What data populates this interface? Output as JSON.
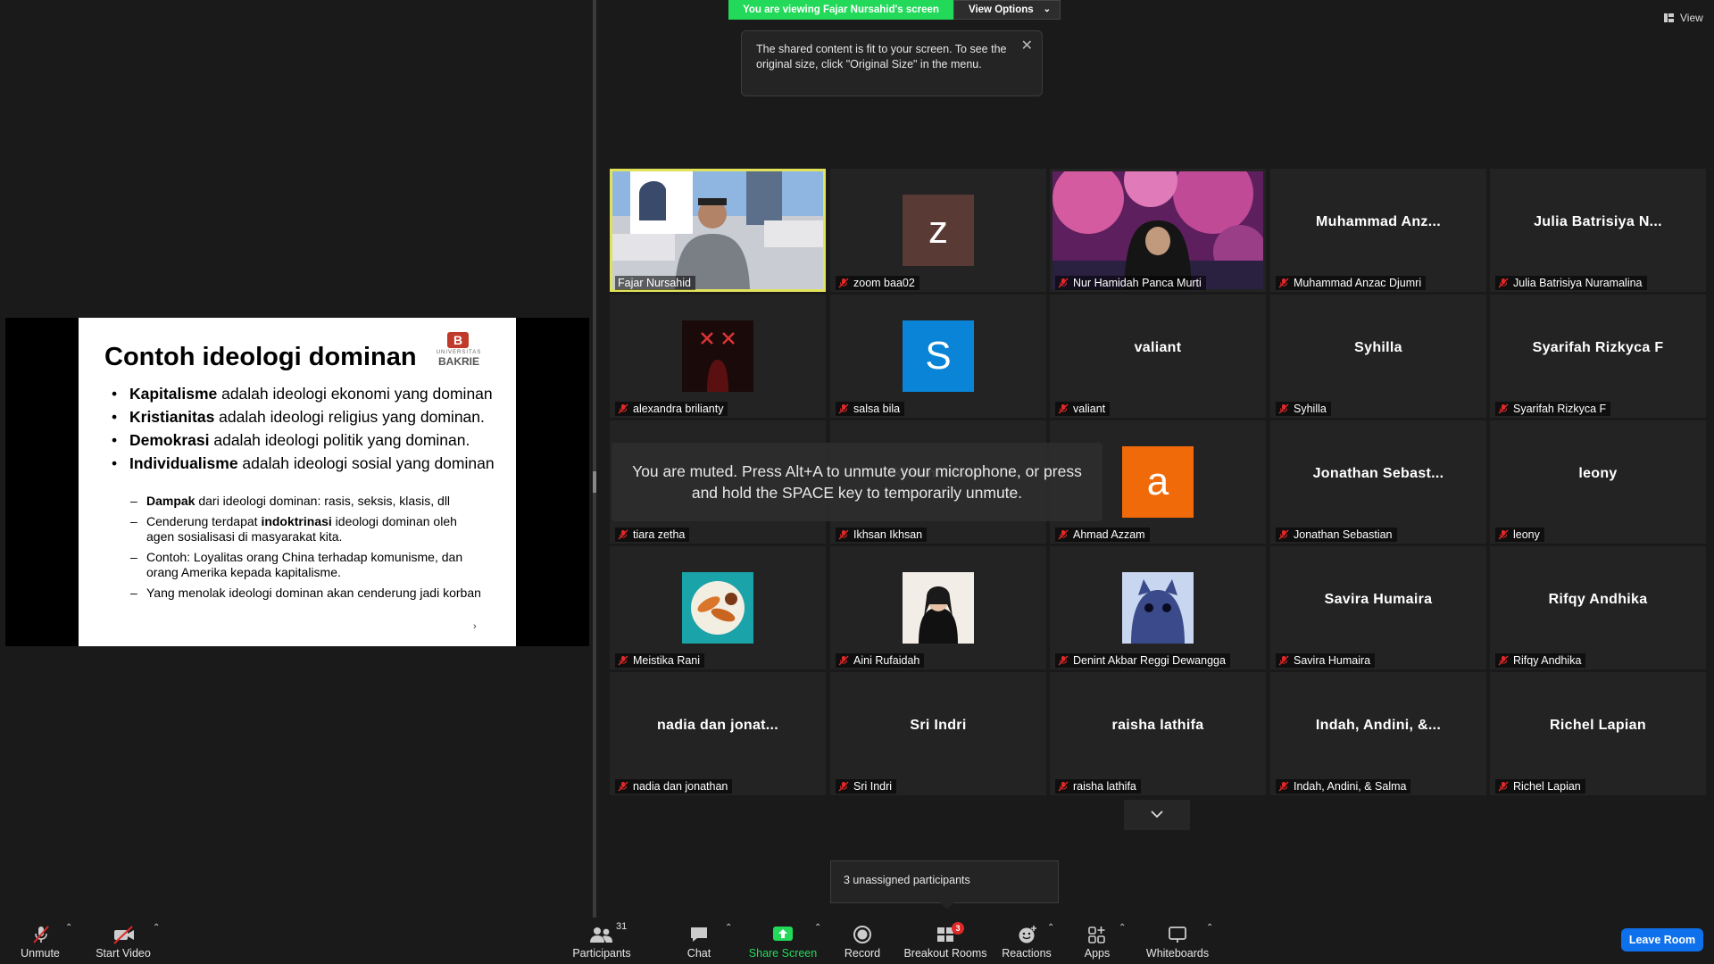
{
  "banner": {
    "viewing": "You are viewing Fajar Nursahid's screen",
    "view_options": "View Options"
  },
  "tooltip": {
    "text": "The shared content is fit to your screen. To see the original size, click \"Original Size\" in the menu."
  },
  "view_button": {
    "label": "View"
  },
  "slide": {
    "title": "Contoh ideologi dominan",
    "logo": {
      "line1": "UNIVERSITAS",
      "line2": "BAKRIE",
      "mark": "B"
    },
    "bullets": [
      {
        "bold": "Kapitalisme",
        "rest": " adalah ideologi ekonomi yang dominan"
      },
      {
        "bold": "Kristianitas",
        "rest": " adalah ideologi religius yang dominan."
      },
      {
        "bold": "Demokrasi",
        "rest": " adalah ideologi politik yang dominan."
      },
      {
        "bold": "Individualisme",
        "rest": " adalah ideologi sosial yang dominan"
      }
    ],
    "sub_bullets": [
      {
        "bold1": "Dampak",
        "rest1": " dari ideologi dominan: rasis, seksis, klasis, dll",
        "bold2": "",
        "rest2": ""
      },
      {
        "bold1": "",
        "rest1": "Cenderung terdapat ",
        "bold2": "indoktrinasi",
        "rest2": " ideologi dominan oleh agen sosialisasi di masyarakat kita."
      },
      {
        "bold1": "",
        "rest1": "Contoh: Loyalitas orang China terhadap komunisme, dan orang Amerika kepada kapitalisme.",
        "bold2": "",
        "rest2": ""
      },
      {
        "bold1": "",
        "rest1": "Yang menolak ideologi dominan akan cenderung jadi korban",
        "bold2": "",
        "rest2": ""
      }
    ],
    "corner_mark": "›"
  },
  "muted_notice": {
    "text": "You are muted. Press Alt+A to unmute your microphone, or press and hold the SPACE key to temporarily unmute."
  },
  "unassigned": {
    "text": "3 unassigned participants"
  },
  "tiles": [
    {
      "label": "Fajar Nursahid",
      "big": "",
      "kind": "video-fajar",
      "muted": false,
      "active": true
    },
    {
      "label": "zoom baa02",
      "big": "",
      "kind": "avatar",
      "avatar_letter": "z",
      "avatar_color": "#5a3a34",
      "muted": true
    },
    {
      "label": "Nur Hamidah Panca Murti",
      "big": "",
      "kind": "video-nur",
      "muted": true
    },
    {
      "label": "Muhammad Anzac Djumri",
      "big": "Muhammad  Anz...",
      "kind": "name",
      "muted": true
    },
    {
      "label": "Julia Batrisiya Nuramalina",
      "big": "Julia  Batrisiya  N...",
      "kind": "name",
      "muted": true
    },
    {
      "label": "alexandra brilianty",
      "big": "",
      "kind": "pic-dark",
      "muted": true
    },
    {
      "label": "salsa bila",
      "big": "",
      "kind": "avatar",
      "avatar_letter": "S",
      "avatar_color": "#0a84d6",
      "muted": true
    },
    {
      "label": "valiant",
      "big": "valiant",
      "kind": "name",
      "muted": true
    },
    {
      "label": "Syhilla",
      "big": "Syhilla",
      "kind": "name",
      "muted": true
    },
    {
      "label": "Syarifah Rizkyca F",
      "big": "Syarifah Rizkyca F",
      "kind": "name",
      "muted": true
    },
    {
      "label": "tiara zetha",
      "big": "",
      "kind": "name",
      "muted": true
    },
    {
      "label": "Ikhsan Ikhsan",
      "big": "Ikhsan Ikhsan",
      "kind": "name",
      "muted": true
    },
    {
      "label": "Ahmad Azzam",
      "big": "",
      "kind": "avatar",
      "avatar_letter": "a",
      "avatar_color": "#f06a0a",
      "muted": true
    },
    {
      "label": "Jonathan Sebastian",
      "big": "Jonathan  Sebast...",
      "kind": "name",
      "muted": true
    },
    {
      "label": "leony",
      "big": "leony",
      "kind": "name",
      "muted": true
    },
    {
      "label": "Meistika Rani",
      "big": "",
      "kind": "pic-food",
      "muted": true
    },
    {
      "label": "Aini Rufaidah",
      "big": "",
      "kind": "pic-person",
      "muted": true
    },
    {
      "label": "Denint Akbar Reggi Dewangga",
      "big": "",
      "kind": "pic-cat",
      "muted": true
    },
    {
      "label": "Savira Humaira",
      "big": "Savira Humaira",
      "kind": "name",
      "muted": true
    },
    {
      "label": "Rifqy Andhika",
      "big": "Rifqy Andhika",
      "kind": "name",
      "muted": true
    },
    {
      "label": "nadia dan jonathan",
      "big": "nadia  dan  jonat...",
      "kind": "name",
      "muted": true
    },
    {
      "label": "Sri Indri",
      "big": "Sri Indri",
      "kind": "name",
      "muted": true
    },
    {
      "label": "raisha lathifa",
      "big": "raisha lathifa",
      "kind": "name",
      "muted": true
    },
    {
      "label": "Indah, Andini, & Salma",
      "big": "Indah,  Andini,  &...",
      "kind": "name",
      "muted": true
    },
    {
      "label": "Richel Lapian",
      "big": "Richel Lapian",
      "kind": "name",
      "muted": true
    }
  ],
  "toolbar": {
    "unmute": "Unmute",
    "start_video": "Start Video",
    "participants": "Participants",
    "participants_count": "31",
    "chat": "Chat",
    "share_screen": "Share Screen",
    "record": "Record",
    "breakout_rooms": "Breakout Rooms",
    "breakout_badge": "3",
    "reactions": "Reactions",
    "apps": "Apps",
    "whiteboards": "Whiteboards",
    "leave_room": "Leave Room"
  },
  "colors": {
    "share_green": "#23d959",
    "leave_blue": "#0e71eb",
    "active_speaker": "#e2e25a",
    "muted_red": "#e02828"
  }
}
